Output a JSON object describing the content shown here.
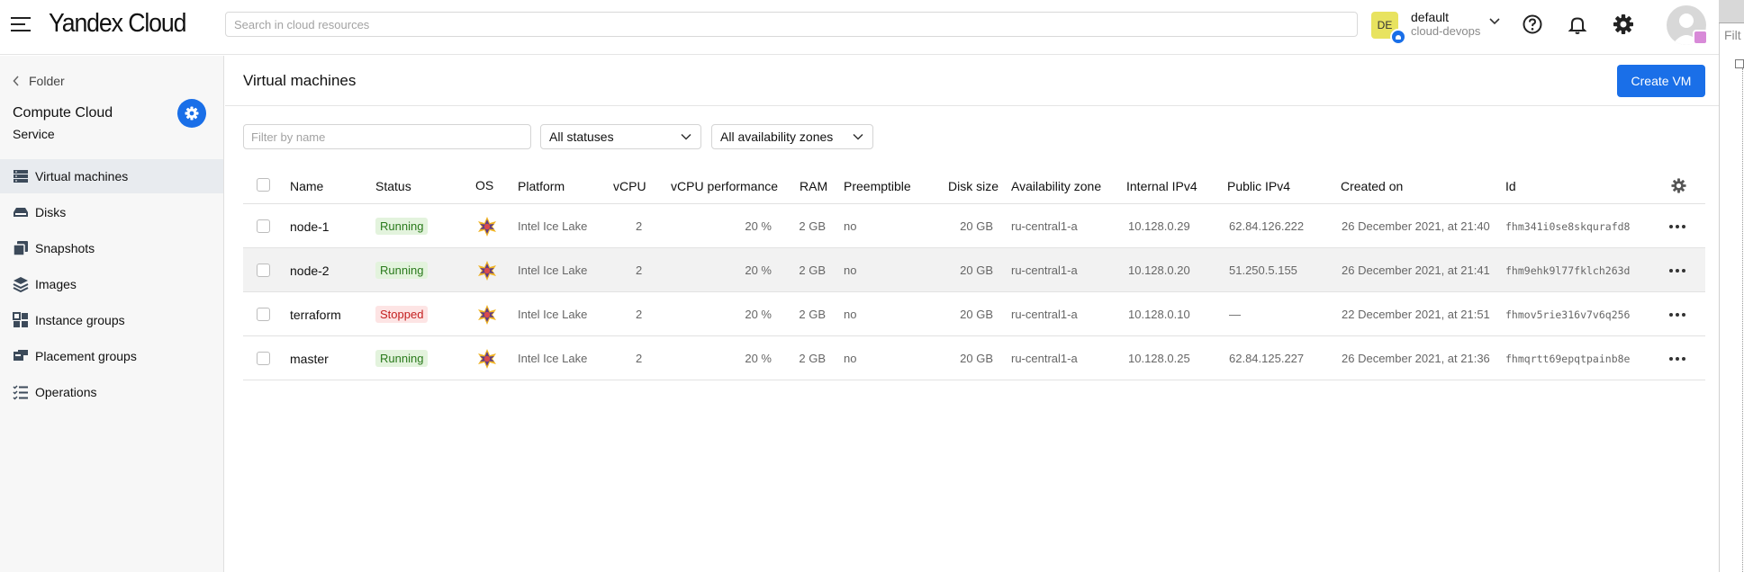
{
  "header": {
    "logo": "Yandex Cloud",
    "search_placeholder": "Search in cloud resources",
    "account": {
      "initials": "DE",
      "name": "default",
      "folder": "cloud-devops"
    }
  },
  "right_panel": {
    "filter_text": "Filt"
  },
  "sidebar": {
    "back_label": "Folder",
    "service_title": "Compute Cloud",
    "service_subtitle": "Service",
    "items": [
      {
        "label": "Virtual machines",
        "icon": "server-icon",
        "active": true
      },
      {
        "label": "Disks",
        "icon": "disk-icon"
      },
      {
        "label": "Snapshots",
        "icon": "snapshot-icon"
      },
      {
        "label": "Images",
        "icon": "layers-icon"
      },
      {
        "label": "Instance groups",
        "icon": "instance-groups-icon"
      },
      {
        "label": "Placement groups",
        "icon": "placement-groups-icon"
      },
      {
        "label": "Operations",
        "icon": "list-icon"
      }
    ]
  },
  "main": {
    "title": "Virtual machines",
    "create_button": "Create VM",
    "filter_placeholder": "Filter by name",
    "status_select": "All statuses",
    "zone_select": "All availability zones",
    "columns": [
      "Name",
      "Status",
      "OS",
      "Platform",
      "vCPU",
      "vCPU performance",
      "RAM",
      "Preemptible",
      "Disk size",
      "Availability zone",
      "Internal IPv4",
      "Public IPv4",
      "Created on",
      "Id"
    ],
    "rows": [
      {
        "name": "node-1",
        "status": "Running",
        "platform": "Intel Ice Lake",
        "vcpu": "2",
        "perf": "20 %",
        "ram": "2 GB",
        "preemptible": "no",
        "disk": "20 GB",
        "zone": "ru-central1-a",
        "internal_ip": "10.128.0.29",
        "public_ip": "62.84.126.222",
        "created": "26 December 2021, at 21:40",
        "id": "fhm341i0se8skqurafd8"
      },
      {
        "name": "node-2",
        "status": "Running",
        "platform": "Intel Ice Lake",
        "vcpu": "2",
        "perf": "20 %",
        "ram": "2 GB",
        "preemptible": "no",
        "disk": "20 GB",
        "zone": "ru-central1-a",
        "internal_ip": "10.128.0.20",
        "public_ip": "51.250.5.155",
        "created": "26 December 2021, at 21:41",
        "id": "fhm9ehk9l77fklch263d"
      },
      {
        "name": "terraform",
        "status": "Stopped",
        "platform": "Intel Ice Lake",
        "vcpu": "2",
        "perf": "20 %",
        "ram": "2 GB",
        "preemptible": "no",
        "disk": "20 GB",
        "zone": "ru-central1-a",
        "internal_ip": "10.128.0.10",
        "public_ip": "—",
        "created": "22 December 2021, at 21:51",
        "id": "fhmov5rie316v7v6q256"
      },
      {
        "name": "master",
        "status": "Running",
        "platform": "Intel Ice Lake",
        "vcpu": "2",
        "perf": "20 %",
        "ram": "2 GB",
        "preemptible": "no",
        "disk": "20 GB",
        "zone": "ru-central1-a",
        "internal_ip": "10.128.0.25",
        "public_ip": "62.84.125.227",
        "created": "26 December 2021, at 21:36",
        "id": "fhmqrtt69epqtpainb8e"
      }
    ]
  },
  "colors": {
    "accent": "#1a6fe8",
    "running_bg": "#e3f3dd",
    "stopped_bg": "#fde4e4"
  }
}
